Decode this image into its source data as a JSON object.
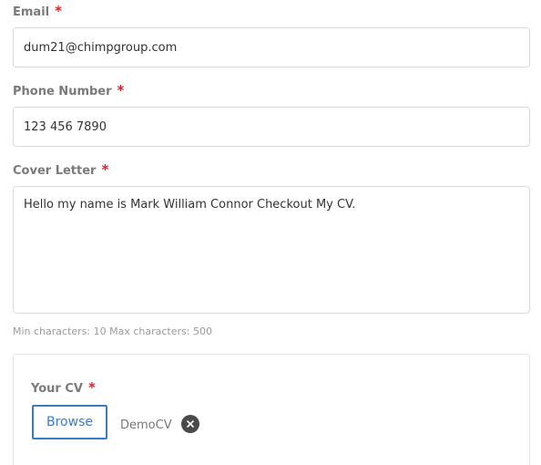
{
  "email": {
    "label": "Email",
    "required_mark": "*",
    "value": "dum21@chimpgroup.com"
  },
  "phone": {
    "label": "Phone Number",
    "required_mark": "*",
    "value": "123 456 7890"
  },
  "cover_letter": {
    "label": "Cover Letter",
    "required_mark": "*",
    "value": "Hello my name is Mark William Connor Checkout My CV.",
    "hint": "Min characters: 10 Max characters: 500"
  },
  "cv": {
    "label": "Your CV",
    "required_mark": "*",
    "browse_label": "Browse",
    "file_name": "DemoCV",
    "remove_icon": "close-icon"
  },
  "colors": {
    "required": "#e0202c",
    "accent": "#3a7bc8",
    "label": "#7a7a7a",
    "border": "#d9d9d9"
  }
}
